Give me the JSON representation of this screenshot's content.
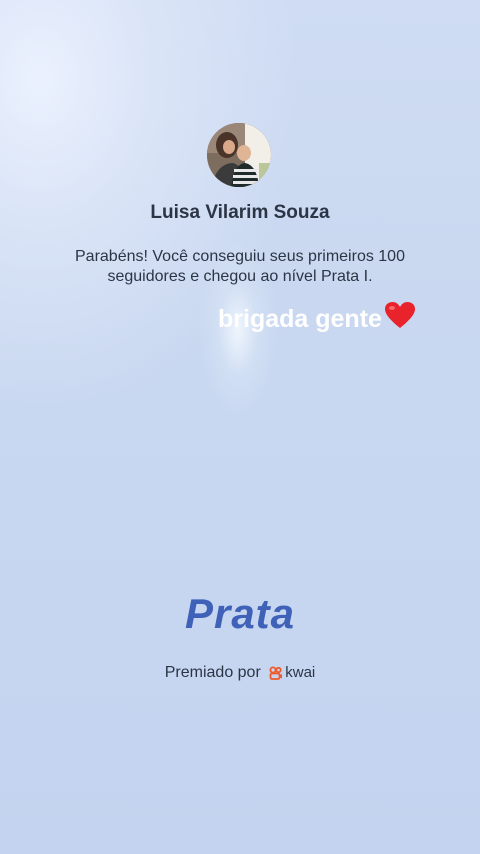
{
  "profile": {
    "name": "Luisa Vilarim Souza",
    "avatar": "profile-photo"
  },
  "message": {
    "line1": "Parabéns! Você conseguiu seus primeiros 100",
    "line2": "seguidores e chegou ao nível Prata I."
  },
  "overlay": {
    "text": "brigada gente",
    "emoji_icon": "red-heart-icon"
  },
  "level": {
    "name": "Prata"
  },
  "award": {
    "label": "Premiado por",
    "brand_icon": "kwai-logo-icon",
    "brand": "kwai",
    "brand_color": "#f05a28"
  },
  "colors": {
    "background": "#c9d8f0",
    "level_title": "#3f62b8",
    "text": "#2b3545"
  }
}
